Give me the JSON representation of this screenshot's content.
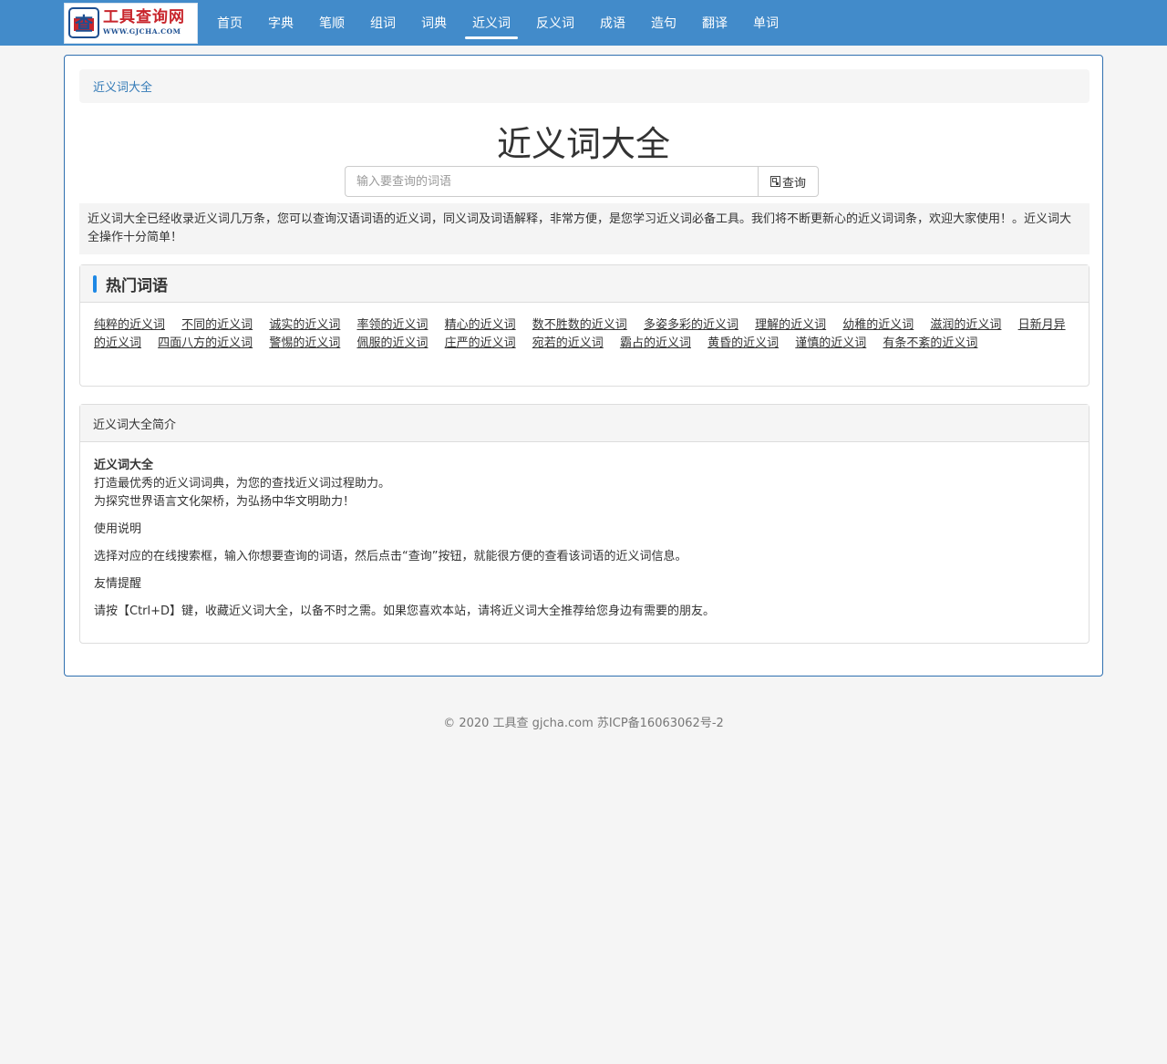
{
  "logo": {
    "title": "工具查询网",
    "url": "WWW.GJCHA.COM",
    "mark_char": "查"
  },
  "nav": [
    {
      "label": "首页"
    },
    {
      "label": "字典"
    },
    {
      "label": "笔顺"
    },
    {
      "label": "组词"
    },
    {
      "label": "词典"
    },
    {
      "label": "近义词",
      "active": true
    },
    {
      "label": "反义词"
    },
    {
      "label": "成语"
    },
    {
      "label": "造句"
    },
    {
      "label": "翻译"
    },
    {
      "label": "单词"
    }
  ],
  "breadcrumb": "近义词大全",
  "page_title": "近义词大全",
  "search": {
    "placeholder": "输入要查询的词语",
    "value": "",
    "button_label": "查询"
  },
  "intro_text": "近义词大全已经收录近义词几万条，您可以查询汉语词语的近义词，同义词及词语解释，非常方便，是您学习近义词必备工具。我们将不断更新心的近义词词条，欢迎大家使用！。近义词大全操作十分简单！",
  "hot": {
    "title": "热门词语",
    "words": [
      "纯粹的近义词",
      "不同的近义词",
      "诚实的近义词",
      "率领的近义词",
      "精心的近义词",
      "数不胜数的近义词",
      "多姿多彩的近义词",
      "理解的近义词",
      "幼稚的近义词",
      "滋润的近义词",
      "日新月异的近义词",
      "四面八方的近义词",
      "警惕的近义词",
      "佩服的近义词",
      "庄严的近义词",
      "宛若的近义词",
      "霸占的近义词",
      "黄昏的近义词",
      "谨慎的近义词",
      "有条不紊的近义词"
    ]
  },
  "about": {
    "heading": "近义词大全简介",
    "name": "近义词大全",
    "line1": "打造最优秀的近义词词典，为您的查找近义词过程助力。",
    "line2": "为探究世界语言文化架桥，为弘扬中华文明助力！",
    "usage_title": "使用说明",
    "usage_text": "选择对应的在线搜索框，输入你想要查询的词语，然后点击“查询”按钮，就能很方便的查看该词语的近义词信息。",
    "tip_title": "友情提醒",
    "tip_text": "请按【Ctrl+D】键，收藏近义词大全，以备不时之需。如果您喜欢本站，请将近义词大全推荐给您身边有需要的朋友。"
  },
  "footer": "© 2020 工具查 gjcha.com 苏ICP备16063062号-2",
  "colors": {
    "navbar": "#428bca",
    "link": "#337ab7",
    "accent_bar": "#1e88e5",
    "container_border": "#2f6fb0"
  }
}
